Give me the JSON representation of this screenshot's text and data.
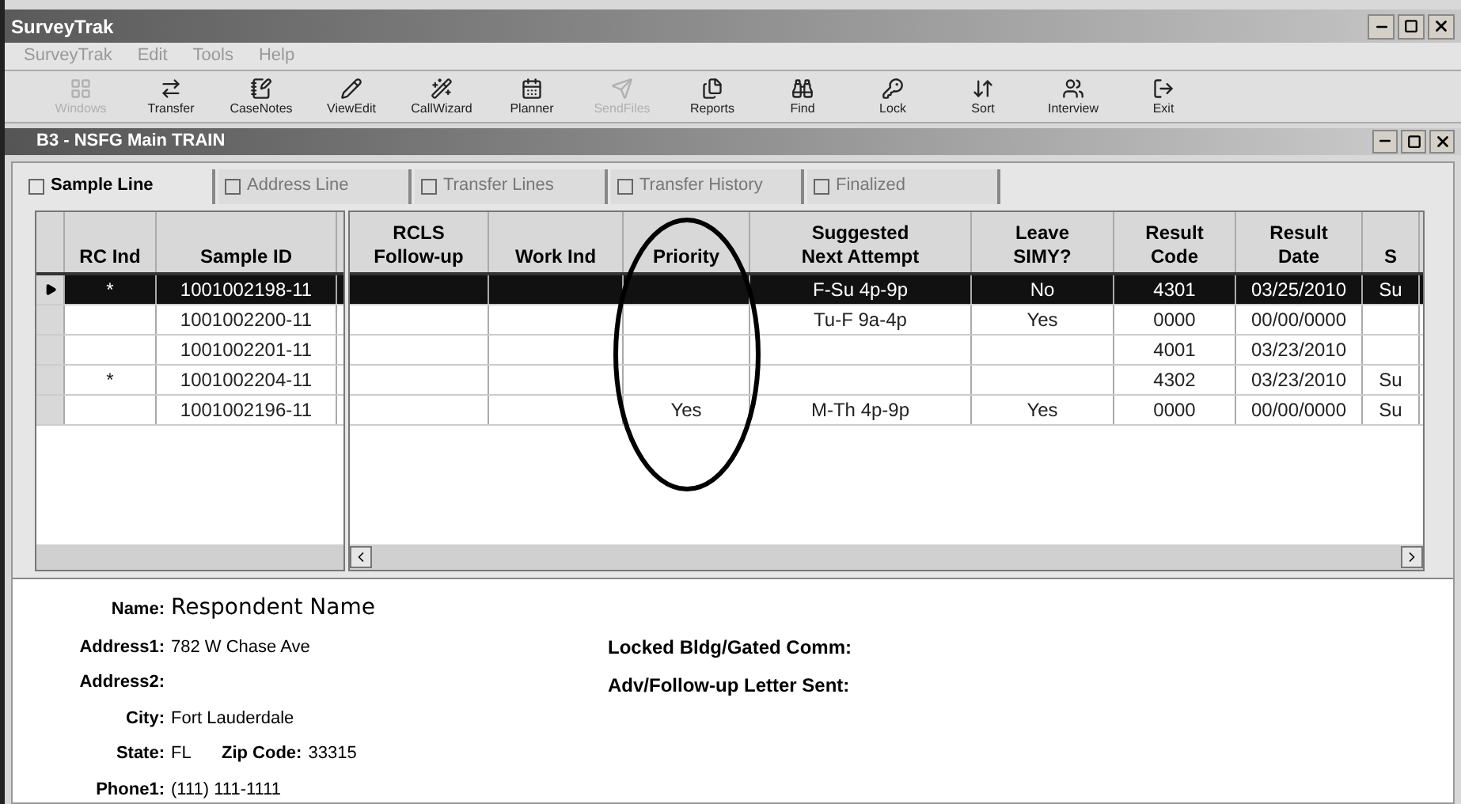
{
  "window": {
    "title": "SurveyTrak"
  },
  "menu": [
    "SurveyTrak",
    "Edit",
    "Tools",
    "Help"
  ],
  "toolbar": [
    {
      "label": "Windows",
      "disabled": true
    },
    {
      "label": "Transfer",
      "disabled": false
    },
    {
      "label": "CaseNotes",
      "disabled": false
    },
    {
      "label": "ViewEdit",
      "disabled": false
    },
    {
      "label": "CallWizard",
      "disabled": false
    },
    {
      "label": "Planner",
      "disabled": false
    },
    {
      "label": "SendFiles",
      "disabled": true
    },
    {
      "label": "Reports",
      "disabled": false
    },
    {
      "label": "Find",
      "disabled": false
    },
    {
      "label": "Lock",
      "disabled": false
    },
    {
      "label": "Sort",
      "disabled": false
    },
    {
      "label": "Interview",
      "disabled": false
    },
    {
      "label": "Exit",
      "disabled": false
    }
  ],
  "child_window": {
    "title": "B3 - NSFG Main TRAIN"
  },
  "tabs": [
    {
      "label": "Sample Line",
      "selected": true
    },
    {
      "label": "Address Line",
      "selected": false
    },
    {
      "label": "Transfer Lines",
      "selected": false
    },
    {
      "label": "Transfer History",
      "selected": false
    },
    {
      "label": "Finalized",
      "selected": false
    }
  ],
  "grid": {
    "left_columns": [
      "RC Ind",
      "Sample ID"
    ],
    "right_columns": [
      "RCLS\nFollow-up",
      "Work Ind",
      "Priority",
      "Suggested\nNext Attempt",
      "Leave\nSIMY?",
      "Result\nCode",
      "Result\nDate",
      "S"
    ],
    "rows": [
      {
        "selected": true,
        "rc_ind": "*",
        "sample_id": "1001002198-11",
        "cells": [
          "",
          "",
          "",
          "F-Su 4p-9p",
          "No",
          "4301",
          "03/25/2010",
          "Su"
        ]
      },
      {
        "selected": false,
        "rc_ind": "",
        "sample_id": "1001002200-11",
        "cells": [
          "",
          "",
          "",
          "Tu-F 9a-4p",
          "Yes",
          "0000",
          "00/00/0000",
          ""
        ]
      },
      {
        "selected": false,
        "rc_ind": "",
        "sample_id": "1001002201-11",
        "cells": [
          "",
          "",
          "",
          "",
          "",
          "4001",
          "03/23/2010",
          ""
        ]
      },
      {
        "selected": false,
        "rc_ind": "*",
        "sample_id": "1001002204-11",
        "cells": [
          "",
          "",
          "",
          "",
          "",
          "4302",
          "03/23/2010",
          "Su"
        ]
      },
      {
        "selected": false,
        "rc_ind": "",
        "sample_id": "1001002196-11",
        "cells": [
          "",
          "",
          "Yes",
          "M-Th 4p-9p",
          "Yes",
          "0000",
          "00/00/0000",
          "Su"
        ]
      }
    ]
  },
  "details": {
    "name": {
      "label": "Name:",
      "value": "Respondent Name"
    },
    "left": [
      {
        "label": "Address1:",
        "value": "782 W Chase Ave"
      },
      {
        "label": "Address2:"
      },
      {
        "label": "City:",
        "value": "Fort Lauderdale"
      }
    ],
    "state": {
      "label": "State:",
      "value": "FL"
    },
    "zip": {
      "label": "Zip Code:",
      "value": "33315"
    },
    "phone": {
      "label": "Phone1:",
      "value": "(111) 111-1111"
    },
    "right": [
      "Locked Bldg/Gated Comm:",
      "Adv/Follow-up Letter Sent:"
    ]
  }
}
